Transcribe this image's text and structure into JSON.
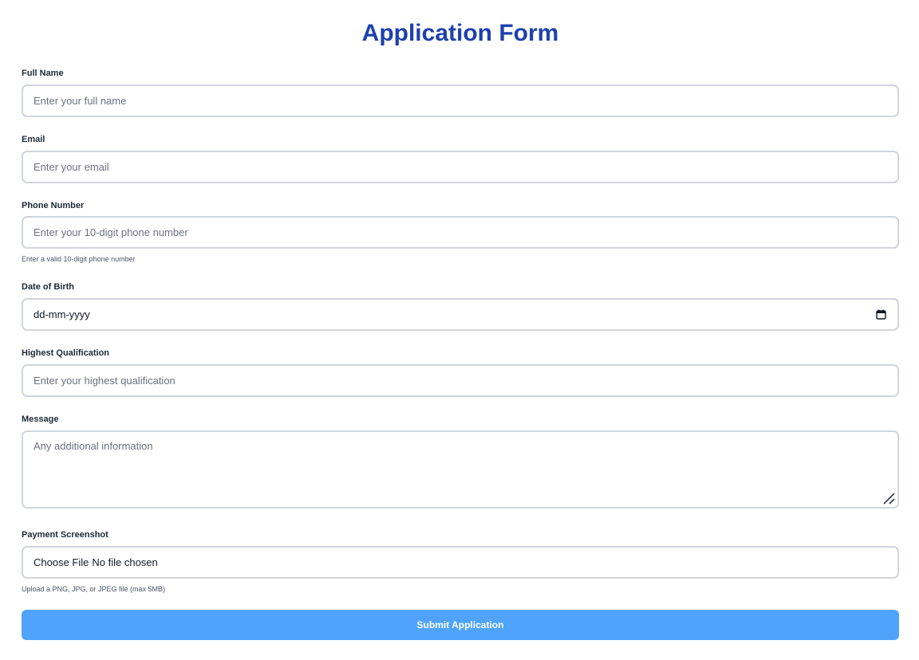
{
  "form": {
    "title": "Application Form",
    "full_name": {
      "label": "Full Name",
      "placeholder": "Enter your full name",
      "value": ""
    },
    "email": {
      "label": "Email",
      "placeholder": "Enter your email",
      "value": ""
    },
    "phone": {
      "label": "Phone Number",
      "placeholder": "Enter your 10-digit phone number",
      "value": "",
      "hint": "Enter a valid 10-digit phone number"
    },
    "dob": {
      "label": "Date of Birth",
      "value": "dd-mm-yyyy",
      "icon": "calendar-icon"
    },
    "qualification": {
      "label": "Highest Qualification",
      "placeholder": "Enter your highest qualification",
      "value": ""
    },
    "message": {
      "label": "Message",
      "placeholder": "Any additional information",
      "value": ""
    },
    "payment": {
      "label": "Payment Screenshot",
      "button_label": "Choose File",
      "status": "No file chosen",
      "hint": "Upload a PNG, JPG, or JPEG file (max 5MB)"
    },
    "submit_label": "Submit Application"
  },
  "colors": {
    "title": "#1e40af",
    "input_border": "#d1d5db",
    "submit_background": "#4fa3fb",
    "submit_text": "#ffffff"
  }
}
